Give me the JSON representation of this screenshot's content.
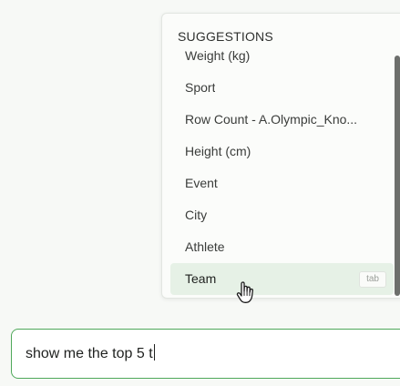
{
  "suggestions": {
    "header": "SUGGESTIONS",
    "items": [
      {
        "label": "Weight (kg)"
      },
      {
        "label": "Sport"
      },
      {
        "label": "Row Count - A.Olympic_Kno..."
      },
      {
        "label": "Height (cm)"
      },
      {
        "label": "Event"
      },
      {
        "label": "City"
      },
      {
        "label": "Athlete"
      },
      {
        "label": "Team",
        "tab_hint": "tab"
      }
    ]
  },
  "input": {
    "value": "show me the top 5 t"
  },
  "colors": {
    "accent": "#4fa85a",
    "highlight": "#e6f1e6",
    "background": "#f7f9f6"
  },
  "icons": {
    "cursor": "hand-pointer-icon"
  }
}
